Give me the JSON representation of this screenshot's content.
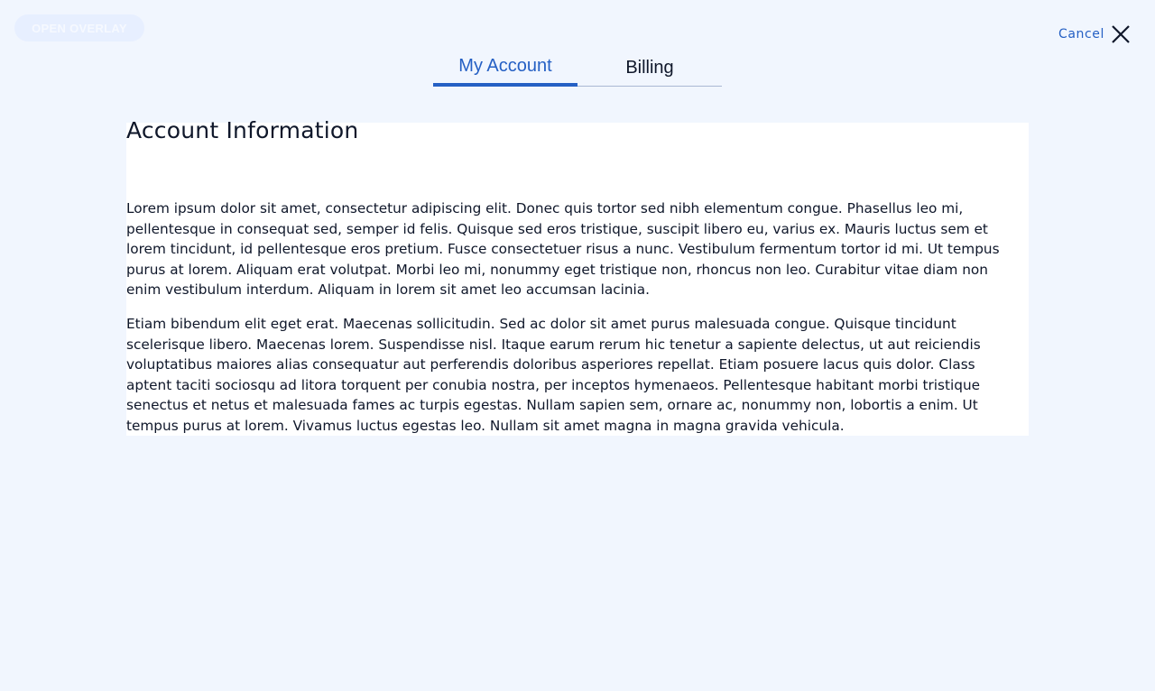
{
  "overlay_button": {
    "label": "OPEN OVERLAY"
  },
  "cancel": {
    "label": "Cancel",
    "icon": "close-icon"
  },
  "tabs": [
    {
      "label": "My Account",
      "active": true
    },
    {
      "label": "Billing",
      "active": false
    }
  ],
  "account": {
    "title": "Account Information",
    "paragraphs": [
      "Lorem ipsum dolor sit amet, consectetur adipiscing elit. Donec quis tortor sed nibh elementum congue. Phasellus leo mi, pellentesque in consequat sed, semper id felis. Quisque sed eros tristique, suscipit libero eu, varius ex. Mauris luctus sem et lorem tincidunt, id pellentesque eros pretium. Fusce consectetuer risus a nunc. Vestibulum fermentum tortor id mi. Ut tempus purus at lorem. Aliquam erat volutpat. Morbi leo mi, nonummy eget tristique non, rhoncus non leo. Curabitur vitae diam non enim vestibulum interdum. Aliquam in lorem sit amet leo accumsan lacinia.",
      "Etiam bibendum elit eget erat. Maecenas sollicitudin. Sed ac dolor sit amet purus malesuada congue. Quisque tincidunt scelerisque libero. Maecenas lorem. Suspendisse nisl. Itaque earum rerum hic tenetur a sapiente delectus, ut aut reiciendis voluptatibus maiores alias consequatur aut perferendis doloribus asperiores repellat. Etiam posuere lacus quis dolor. Class aptent taciti sociosqu ad litora torquent per conubia nostra, per inceptos hymenaeos. Pellentesque habitant morbi tristique senectus et netus et malesuada fames ac turpis egestas. Nullam sapien sem, ornare ac, nonummy non, lobortis a enim. Ut tempus purus at lorem. Vivamus luctus egestas leo. Nullam sit amet magna in magna gravida vehicula."
    ]
  },
  "colors": {
    "background": "#f1f6fe",
    "accent": "#2560c4",
    "text": "#0f172a",
    "panel": "#ffffff"
  }
}
